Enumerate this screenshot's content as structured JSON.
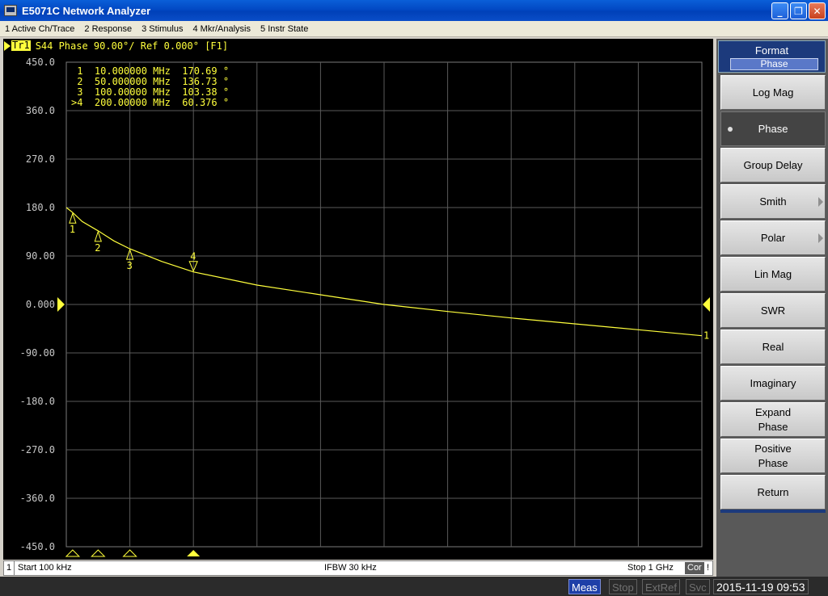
{
  "window": {
    "title": "E5071C Network Analyzer"
  },
  "menu": [
    "1 Active Ch/Trace",
    "2 Response",
    "3 Stimulus",
    "4 Mkr/Analysis",
    "5 Instr State"
  ],
  "trace": {
    "label": "Tr1",
    "params": "S44 Phase 90.00°/ Ref 0.000° [F1]"
  },
  "markers": [
    {
      "num": "1",
      "line": " 1  10.000000 MHz  170.69 °"
    },
    {
      "num": "2",
      "line": " 2  50.000000 MHz  136.73 °"
    },
    {
      "num": "3",
      "line": " 3  100.00000 MHz  103.38 °"
    },
    {
      "num": "4",
      "line": ">4  200.00000 MHz  60.376 °"
    }
  ],
  "chart_data": {
    "type": "line",
    "xlabel": "",
    "ylabel": "",
    "x_range": [
      0.0001,
      1000
    ],
    "x_unit": "MHz",
    "ylim": [
      -450,
      450
    ],
    "yticks": [
      "450.0",
      "360.0",
      "270.0",
      "180.0",
      "90.00",
      "0.000",
      "-90.00",
      "-180.0",
      "-270.0",
      "-360.0",
      "-450.0"
    ],
    "grid": true,
    "trace_color": "#ffff3c",
    "series": [
      {
        "x": [
          0.1,
          10,
          25,
          50,
          75,
          100,
          150,
          200,
          300,
          400,
          500,
          600,
          700,
          800,
          900,
          1000
        ],
        "y": [
          180,
          170.69,
          154,
          136.73,
          118,
          103.38,
          80,
          60.376,
          36,
          18,
          0,
          -13,
          -25,
          -36,
          -47,
          -58
        ]
      }
    ],
    "markers": [
      {
        "n": "1",
        "x": 10,
        "y": 170.69
      },
      {
        "n": "2",
        "x": 50,
        "y": 136.73
      },
      {
        "n": "3",
        "x": 100,
        "y": 103.38
      },
      {
        "n": "4",
        "x": 200,
        "y": 60.376,
        "active": true
      }
    ],
    "ref_value": 0,
    "end_label": "1"
  },
  "status": {
    "channel": "1",
    "start": "Start 100 kHz",
    "ifbw": "IFBW 30 kHz",
    "stop": "Stop 1 GHz",
    "cor": "Cor",
    "bang": "!"
  },
  "softkeys": {
    "title": "Format",
    "current": "Phase",
    "items": [
      {
        "label": "Log Mag"
      },
      {
        "label": "Phase",
        "active": true
      },
      {
        "label": "Group Delay"
      },
      {
        "label": "Smith",
        "submenu": true
      },
      {
        "label": "Polar",
        "submenu": true
      },
      {
        "label": "Lin Mag"
      },
      {
        "label": "SWR"
      },
      {
        "label": "Real"
      },
      {
        "label": "Imaginary"
      },
      {
        "label": "Expand Phase"
      },
      {
        "label": "Positive Phase"
      }
    ],
    "return": "Return"
  },
  "bottom": {
    "meas": "Meas",
    "stop": "Stop",
    "extref": "ExtRef",
    "svc": "Svc",
    "datetime": "2015-11-19 09:53"
  }
}
